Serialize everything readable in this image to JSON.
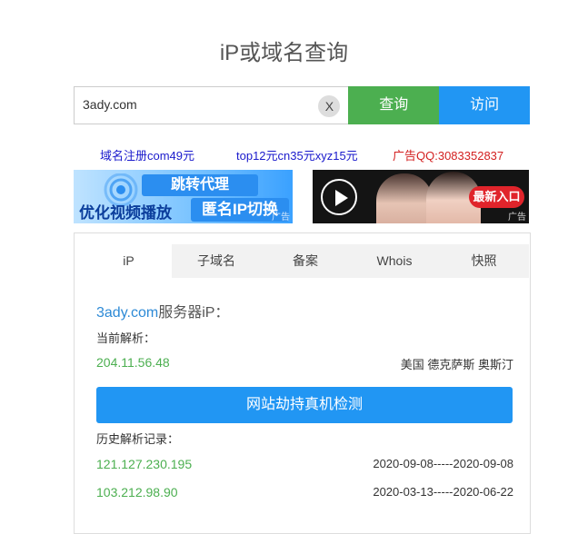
{
  "page": {
    "title": "iP或域名查询"
  },
  "search": {
    "value": "3ady.com",
    "clear_label": "X",
    "query_label": "查询",
    "visit_label": "访问"
  },
  "ad_links": [
    {
      "text": "域名注册com49元",
      "color": "#1a1acc"
    },
    {
      "text": "top12元cn35元xyz15元",
      "color": "#1a1acc"
    },
    {
      "text": "广告QQ:3083352837",
      "color": "#d32020"
    }
  ],
  "banners": {
    "left": {
      "top_text": "跳转代理",
      "bottom_left": "优化视频播放",
      "bottom_right": "匿名IP切换",
      "ad_mark": "广告"
    },
    "right": {
      "button_text": "最新入口",
      "ad_mark": "广告"
    }
  },
  "tabs": [
    {
      "label": "iP",
      "active": true
    },
    {
      "label": "子域名",
      "active": false
    },
    {
      "label": "备案",
      "active": false
    },
    {
      "label": "Whois",
      "active": false
    },
    {
      "label": "快照",
      "active": false
    }
  ],
  "result": {
    "domain": "3ady.com",
    "domain_suffix": "服务器iP：",
    "current_label": "当前解析：",
    "current_ip": "204.11.56.48",
    "current_location": "美国 德克萨斯 奥斯汀",
    "detect_button": "网站劫持真机检测",
    "history_label": "历史解析记录：",
    "history": [
      {
        "ip": "121.127.230.195",
        "range": "2020-09-08-----2020-09-08"
      },
      {
        "ip": "103.212.98.90",
        "range": "2020-03-13-----2020-06-22"
      }
    ]
  },
  "colors": {
    "query_button": "#4caf50",
    "visit_button": "#2196f3",
    "ip_text": "#4caf50",
    "domain_text": "#2d8ad6"
  }
}
